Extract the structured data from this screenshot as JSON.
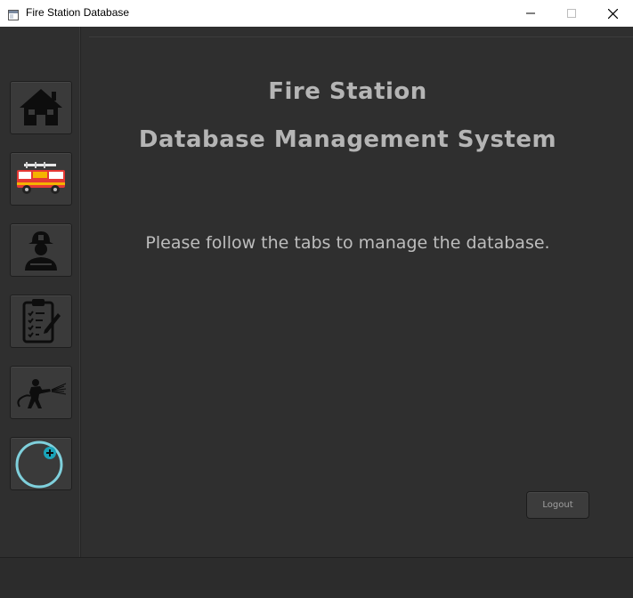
{
  "window": {
    "title": "Fire Station Database"
  },
  "sidebar": {
    "items": [
      {
        "icon": "home-icon"
      },
      {
        "icon": "fire-truck-icon"
      },
      {
        "icon": "firefighter-icon"
      },
      {
        "icon": "clipboard-checklist-icon"
      },
      {
        "icon": "firefighter-hose-icon"
      },
      {
        "icon": "add-circle-icon"
      }
    ]
  },
  "main": {
    "title_line1": "Fire Station",
    "title_line2": "Database Management System",
    "subtitle": "Please follow the tabs to manage the database."
  },
  "actions": {
    "logout_label": "Logout"
  },
  "colors": {
    "background": "#2f2f2f",
    "heading_text": "#b5b5b5",
    "accent_cyan": "#7fd0dc",
    "accent_teal": "#1aa3b8"
  }
}
